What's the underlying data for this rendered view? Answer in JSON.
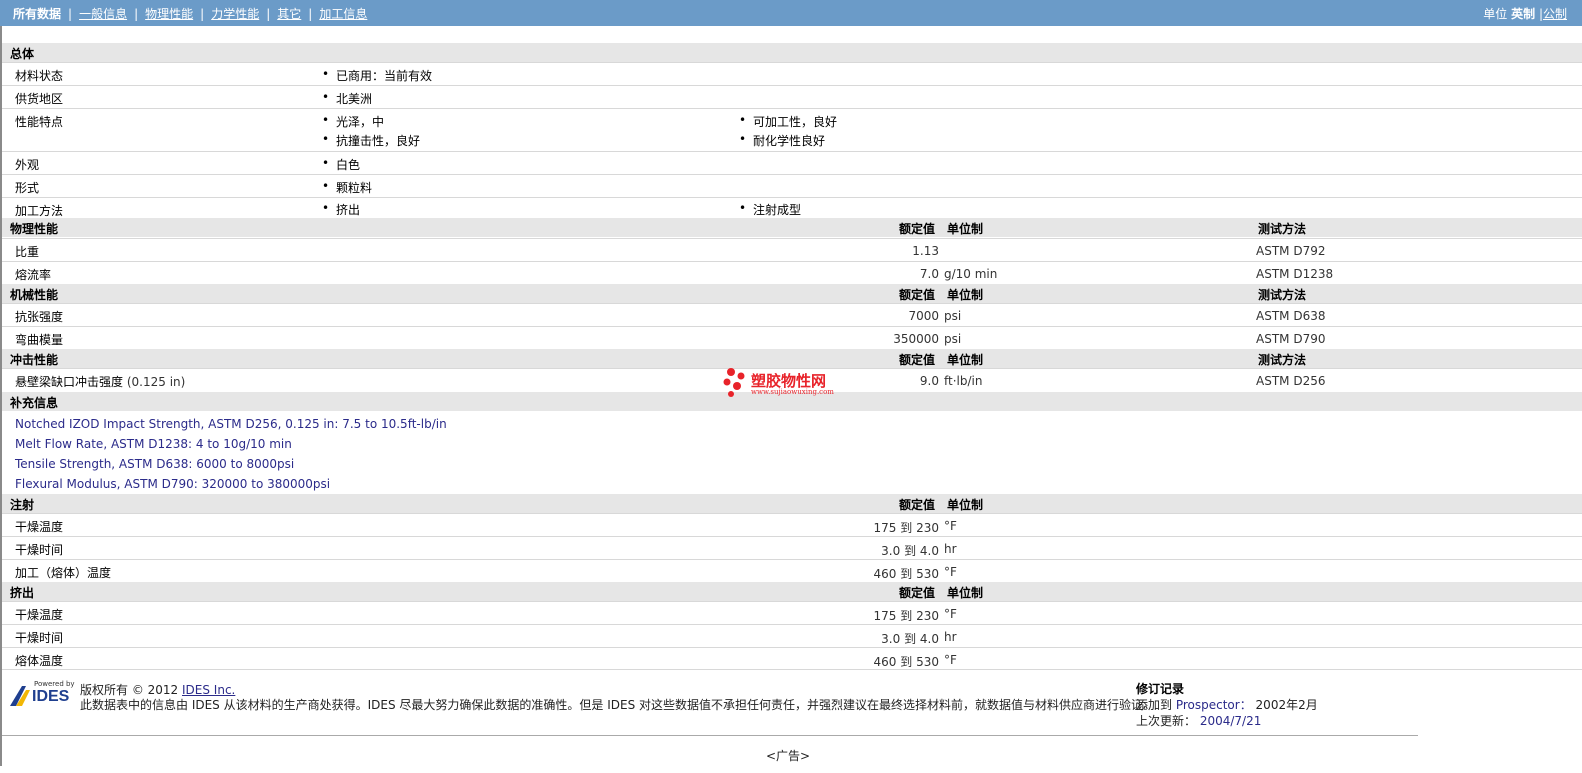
{
  "nav": {
    "tabs": [
      "所有数据",
      "一般信息",
      "物理性能",
      "力学性能",
      "其它",
      "加工信息"
    ],
    "units_label": "单位",
    "unit_imperial": "英制",
    "unit_metric": "公制"
  },
  "general": {
    "title": "总体",
    "rows": [
      {
        "label": "材料状态",
        "c1": [
          "已商用：当前有效"
        ],
        "c2": []
      },
      {
        "label": "供货地区",
        "c1": [
          "北美洲"
        ],
        "c2": []
      },
      {
        "label": "性能特点",
        "c1": [
          "光泽，中",
          "抗撞击性，良好"
        ],
        "c2": [
          "可加工性，良好",
          "耐化学性良好"
        ]
      },
      {
        "label": "外观",
        "c1": [
          "白色"
        ],
        "c2": []
      },
      {
        "label": "形式",
        "c1": [
          "颗粒料"
        ],
        "c2": []
      },
      {
        "label": "加工方法",
        "c1": [
          "挤出"
        ],
        "c2": [
          "注射成型"
        ]
      }
    ]
  },
  "headers": {
    "nominal": "额定值",
    "unit": "单位制",
    "test": "测试方法"
  },
  "physical": {
    "title": "物理性能",
    "rows": [
      {
        "label": "比重",
        "value": "1.13",
        "unit": "",
        "test": "ASTM D792"
      },
      {
        "label": "熔流率",
        "value": "7.0",
        "unit": "g/10 min",
        "test": "ASTM D1238"
      }
    ]
  },
  "mechanical": {
    "title": "机械性能",
    "rows": [
      {
        "label": "抗张强度",
        "value": "7000",
        "unit": "psi",
        "test": "ASTM D638"
      },
      {
        "label": "弯曲模量",
        "value": "350000",
        "unit": "psi",
        "test": "ASTM D790"
      }
    ]
  },
  "impact": {
    "title": "冲击性能",
    "rows": [
      {
        "label": "悬壁梁缺口冲击强度",
        "label_suffix": "(0.125 in)",
        "value": "9.0",
        "unit": "ft·lb/in",
        "test": "ASTM D256"
      }
    ]
  },
  "supplement": {
    "title": "补充信息",
    "notes": [
      "Notched IZOD Impact Strength, ASTM D256, 0.125 in: 7.5 to 10.5ft-lb/in",
      "Melt Flow Rate, ASTM D1238: 4 to 10g/10 min",
      "Tensile Strength, ASTM D638: 6000 to 8000psi",
      "Flexural Modulus, ASTM D790: 320000 to 380000psi"
    ]
  },
  "injection": {
    "title": "注射",
    "rows": [
      {
        "label": "干燥温度",
        "from": "175",
        "to_word": "到",
        "to": "230",
        "unit": "°F"
      },
      {
        "label": "干燥时间",
        "from": "3.0",
        "to_word": "到",
        "to": "4.0",
        "unit": "hr"
      },
      {
        "label": "加工（熔体）温度",
        "from": "460",
        "to_word": "到",
        "to": "530",
        "unit": "°F"
      }
    ]
  },
  "extrusion": {
    "title": "挤出",
    "rows": [
      {
        "label": "干燥温度",
        "from": "175",
        "to_word": "到",
        "to": "230",
        "unit": "°F"
      },
      {
        "label": "干燥时间",
        "from": "3.0",
        "to_word": "到",
        "to": "4.0",
        "unit": "hr"
      },
      {
        "label": "熔体温度",
        "from": "460",
        "to_word": "到",
        "to": "530",
        "unit": "°F"
      }
    ]
  },
  "footer": {
    "logo_small": "Powered by",
    "logo_text": "IDES",
    "copyright": "版权所有 © 2012",
    "company": "IDES Inc.",
    "disclaimer": "此数据表中的信息由 IDES 从该材料的生产商处获得。IDES 尽最大努力确保此数据的准确性。但是 IDES 对这些数据值不承担任何责任，并强烈建议在最终选择材料前，就数据值与材料供应商进行验证。",
    "rev_title": "修订记录",
    "added_label": "添加到",
    "added_target": "Prospector：",
    "added_date": "2002年2月",
    "updated_label": "上次更新：",
    "updated_date": "2004/7/21",
    "ad": "<广告>"
  },
  "watermark": {
    "text": "塑胶物性网",
    "url": "www.sujiaowuxing.com",
    "color": "#e8232a"
  }
}
